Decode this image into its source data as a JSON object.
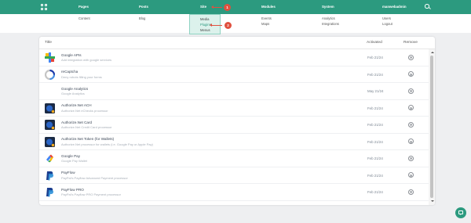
{
  "topbar": {
    "items": [
      "Pages",
      "Posts",
      "Site",
      "Modules",
      "System",
      "manwebadmin"
    ],
    "icons": [
      "grid-icon",
      "search-icon"
    ],
    "color": "#2c9a7f"
  },
  "markers": [
    "1",
    "2"
  ],
  "menu": {
    "pages": [
      "Content"
    ],
    "posts": [
      "Blog"
    ],
    "site": [
      "Media",
      "Plugins",
      "Menus"
    ],
    "site_active": "Plugins",
    "modules": [
      "Events",
      "Maps"
    ],
    "system": [
      "Analytics",
      "Integrations"
    ],
    "user": [
      "Users",
      "Logout"
    ]
  },
  "table": {
    "headers": {
      "title": "Title",
      "activated": "Activated",
      "remove": "Remove"
    },
    "rows": [
      {
        "title": "Google APIs",
        "desc": "Add integration with google services",
        "date": "Feb 21/24",
        "icon": "google-apis-icon"
      },
      {
        "title": "reCaptcha",
        "desc": "Deny robots filling your forms",
        "date": "Feb 21/24",
        "icon": "recaptcha-icon"
      },
      {
        "title": "Google Analytics",
        "desc": "Google Analytics",
        "date": "May 21/24",
        "icon": "google-analytics-icon"
      },
      {
        "title": "Authorize.Net ACH",
        "desc": "Authorize.Net eChecks processor",
        "date": "Feb 21/24",
        "icon": "authorize-net-icon"
      },
      {
        "title": "Authorize.Net Card",
        "desc": "Authorize.Net Credit Card processor",
        "date": "Feb 21/24",
        "icon": "authorize-net-icon"
      },
      {
        "title": "Authorize.Net Token (for Wallets)",
        "desc": "Authorize.Net processor for wallets (i.e. Google Pay or Apple Pay)",
        "date": "Feb 21/24",
        "icon": "authorize-net-icon"
      },
      {
        "title": "Google Pay",
        "desc": "Google Pay Wallet",
        "date": "Feb 21/24",
        "icon": "google-pay-icon"
      },
      {
        "title": "PayFlow",
        "desc": "PayPal's Payflow Advanced Payment processor",
        "date": "Feb 21/24",
        "icon": "paypal-icon"
      },
      {
        "title": "PayFlow PRO",
        "desc": "PayPal's Payflow PRO Payment processor",
        "date": "Feb 21/24",
        "icon": "paypal-icon"
      }
    ]
  },
  "fab_icon": "chat-icon"
}
